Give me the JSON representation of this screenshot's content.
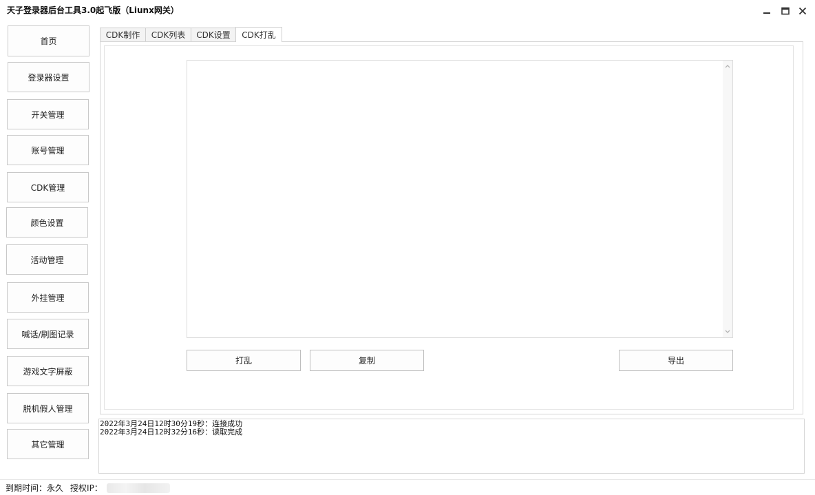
{
  "window": {
    "title": "天子登录器后台工具3.0起飞版（Liunx网关）"
  },
  "sidebar": {
    "items": [
      {
        "label": "首页"
      },
      {
        "label": "登录器设置"
      },
      {
        "label": "开关管理"
      },
      {
        "label": "账号管理"
      },
      {
        "label": "CDK管理"
      },
      {
        "label": "颜色设置"
      },
      {
        "label": "活动管理"
      },
      {
        "label": "外挂管理"
      },
      {
        "label": "喊话/刷图记录"
      },
      {
        "label": "游戏文字屏蔽"
      },
      {
        "label": "脱机假人管理"
      },
      {
        "label": "其它管理"
      }
    ]
  },
  "tabs": [
    {
      "label": "CDK制作"
    },
    {
      "label": "CDK列表"
    },
    {
      "label": "CDK设置"
    },
    {
      "label": "CDK打乱",
      "active": true
    }
  ],
  "panel": {
    "textarea_value": "",
    "buttons": {
      "shuffle": "打乱",
      "copy": "复制",
      "export": "导出"
    }
  },
  "log": {
    "lines": [
      "2022年3月24日12时30分19秒：连接成功",
      "2022年3月24日12时32分16秒：读取完成"
    ]
  },
  "status": {
    "expire_label": "到期时间：",
    "expire_value": "永久",
    "ip_label": "授权IP："
  },
  "colors": {
    "border": "#c9c9c9",
    "background": "#ffffff"
  }
}
